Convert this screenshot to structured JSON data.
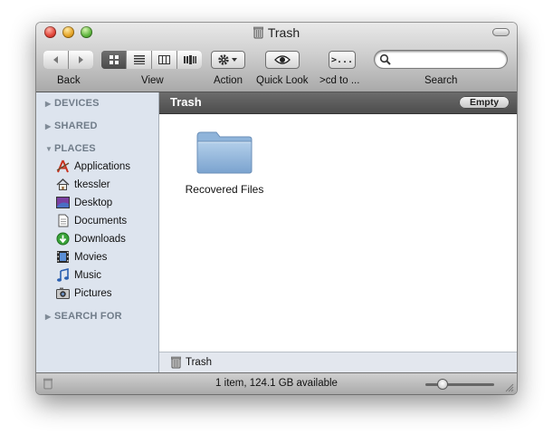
{
  "window": {
    "title": "Trash"
  },
  "toolbar": {
    "back_label": "Back",
    "view_label": "View",
    "action_label": "Action",
    "quicklook_label": "Quick Look",
    "cd_label": ">cd to ...",
    "search_label": "Search",
    "cd_button_text": ">...",
    "view_modes": [
      "icon",
      "list",
      "column",
      "cover-flow"
    ],
    "selected_view_mode": "icon",
    "search_placeholder": ""
  },
  "sidebar": {
    "devices": "DEVICES",
    "shared": "SHARED",
    "places": "PLACES",
    "search_for": "SEARCH FOR",
    "items": [
      {
        "label": "Applications",
        "icon": "applications-icon"
      },
      {
        "label": "tkessler",
        "icon": "home-icon"
      },
      {
        "label": "Desktop",
        "icon": "desktop-icon"
      },
      {
        "label": "Documents",
        "icon": "documents-icon"
      },
      {
        "label": "Downloads",
        "icon": "downloads-icon"
      },
      {
        "label": "Movies",
        "icon": "movies-icon"
      },
      {
        "label": "Music",
        "icon": "music-icon"
      },
      {
        "label": "Pictures",
        "icon": "pictures-icon"
      }
    ]
  },
  "header": {
    "title": "Trash",
    "empty_button": "Empty"
  },
  "files": [
    {
      "name": "Recovered Files",
      "icon": "folder-icon"
    }
  ],
  "pathbar": {
    "label": "Trash"
  },
  "status": {
    "text": "1 item, 124.1 GB available",
    "icon_zoom": 0.25
  },
  "colors": {
    "sidebar_bg": "#dde4ee",
    "header_bg": "#5c5c5c",
    "folder": "#8fb4da"
  }
}
